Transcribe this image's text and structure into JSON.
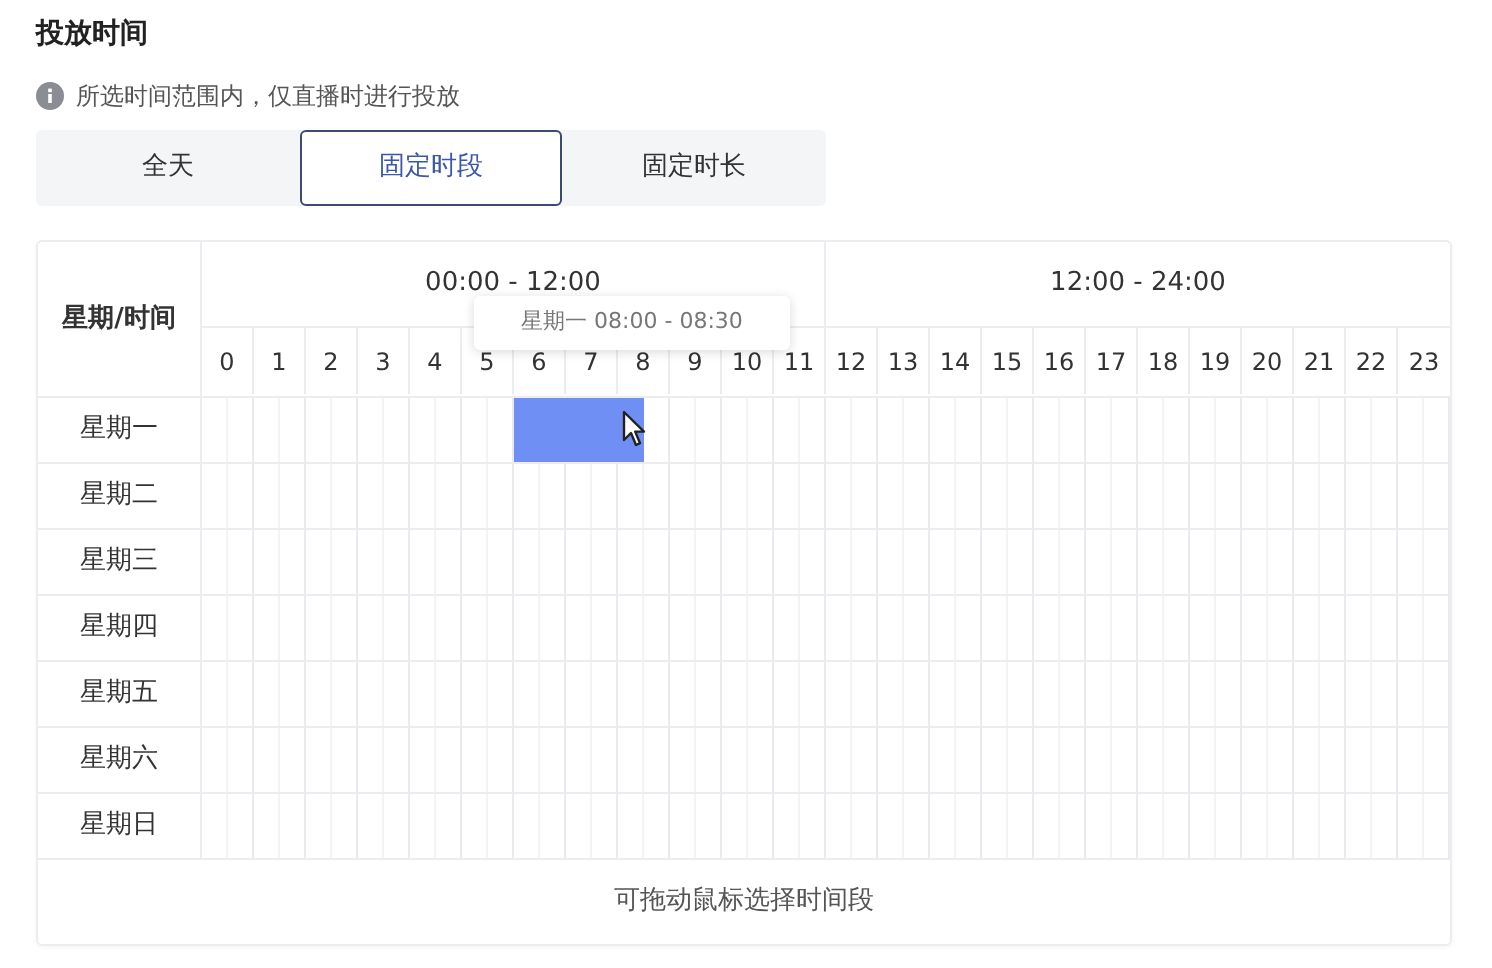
{
  "section_title": "投放时间",
  "notice": "所选时间范围内，仅直播时进行投放",
  "tabs": [
    {
      "label": "全天",
      "selected": false
    },
    {
      "label": "固定时段",
      "selected": true
    },
    {
      "label": "固定时长",
      "selected": false
    }
  ],
  "schedule": {
    "corner_label": "星期/时间",
    "period_headers": [
      "00:00 - 12:00",
      "12:00 - 24:00"
    ],
    "hours": [
      "0",
      "1",
      "2",
      "3",
      "4",
      "5",
      "6",
      "7",
      "8",
      "9",
      "10",
      "11",
      "12",
      "13",
      "14",
      "15",
      "16",
      "17",
      "18",
      "19",
      "20",
      "21",
      "22",
      "23"
    ],
    "days": [
      {
        "label": "星期一",
        "slots_selected": [
          false,
          false,
          false,
          false,
          false,
          false,
          false,
          false,
          false,
          false,
          false,
          false,
          true,
          true,
          true,
          true,
          true,
          false,
          false,
          false,
          false,
          false,
          false,
          false,
          false,
          false,
          false,
          false,
          false,
          false,
          false,
          false,
          false,
          false,
          false,
          false,
          false,
          false,
          false,
          false,
          false,
          false,
          false,
          false,
          false,
          false,
          false,
          false
        ]
      },
      {
        "label": "星期二",
        "slots_selected": [
          false,
          false,
          false,
          false,
          false,
          false,
          false,
          false,
          false,
          false,
          false,
          false,
          false,
          false,
          false,
          false,
          false,
          false,
          false,
          false,
          false,
          false,
          false,
          false,
          false,
          false,
          false,
          false,
          false,
          false,
          false,
          false,
          false,
          false,
          false,
          false,
          false,
          false,
          false,
          false,
          false,
          false,
          false,
          false,
          false,
          false,
          false,
          false
        ]
      },
      {
        "label": "星期三",
        "slots_selected": [
          false,
          false,
          false,
          false,
          false,
          false,
          false,
          false,
          false,
          false,
          false,
          false,
          false,
          false,
          false,
          false,
          false,
          false,
          false,
          false,
          false,
          false,
          false,
          false,
          false,
          false,
          false,
          false,
          false,
          false,
          false,
          false,
          false,
          false,
          false,
          false,
          false,
          false,
          false,
          false,
          false,
          false,
          false,
          false,
          false,
          false,
          false,
          false
        ]
      },
      {
        "label": "星期四",
        "slots_selected": [
          false,
          false,
          false,
          false,
          false,
          false,
          false,
          false,
          false,
          false,
          false,
          false,
          false,
          false,
          false,
          false,
          false,
          false,
          false,
          false,
          false,
          false,
          false,
          false,
          false,
          false,
          false,
          false,
          false,
          false,
          false,
          false,
          false,
          false,
          false,
          false,
          false,
          false,
          false,
          false,
          false,
          false,
          false,
          false,
          false,
          false,
          false,
          false
        ]
      },
      {
        "label": "星期五",
        "slots_selected": [
          false,
          false,
          false,
          false,
          false,
          false,
          false,
          false,
          false,
          false,
          false,
          false,
          false,
          false,
          false,
          false,
          false,
          false,
          false,
          false,
          false,
          false,
          false,
          false,
          false,
          false,
          false,
          false,
          false,
          false,
          false,
          false,
          false,
          false,
          false,
          false,
          false,
          false,
          false,
          false,
          false,
          false,
          false,
          false,
          false,
          false,
          false,
          false
        ]
      },
      {
        "label": "星期六",
        "slots_selected": [
          false,
          false,
          false,
          false,
          false,
          false,
          false,
          false,
          false,
          false,
          false,
          false,
          false,
          false,
          false,
          false,
          false,
          false,
          false,
          false,
          false,
          false,
          false,
          false,
          false,
          false,
          false,
          false,
          false,
          false,
          false,
          false,
          false,
          false,
          false,
          false,
          false,
          false,
          false,
          false,
          false,
          false,
          false,
          false,
          false,
          false,
          false,
          false
        ]
      },
      {
        "label": "星期日",
        "slots_selected": [
          false,
          false,
          false,
          false,
          false,
          false,
          false,
          false,
          false,
          false,
          false,
          false,
          false,
          false,
          false,
          false,
          false,
          false,
          false,
          false,
          false,
          false,
          false,
          false,
          false,
          false,
          false,
          false,
          false,
          false,
          false,
          false,
          false,
          false,
          false,
          false,
          false,
          false,
          false,
          false,
          false,
          false,
          false,
          false,
          false,
          false,
          false,
          false
        ]
      }
    ],
    "tooltip": "星期一 08:00 - 08:30",
    "footer_hint": "可拖动鼠标选择时间段"
  }
}
